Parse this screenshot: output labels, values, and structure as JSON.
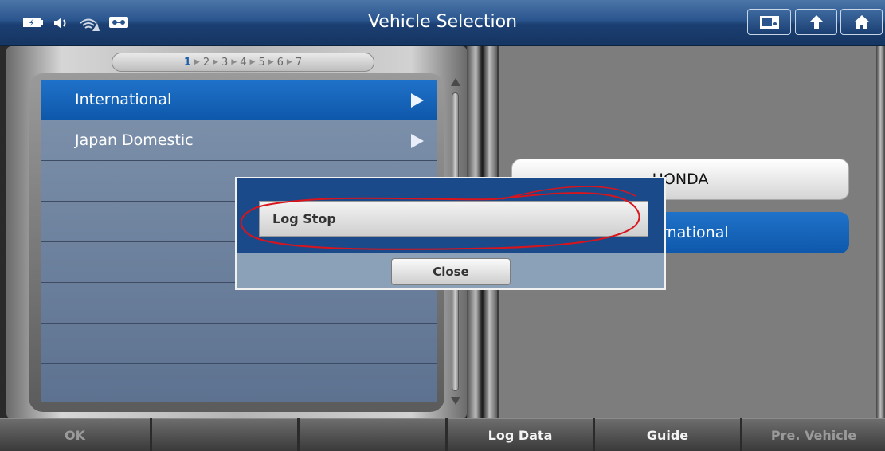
{
  "header": {
    "title": "Vehicle Selection"
  },
  "status_icons": [
    "battery-icon",
    "speaker-icon",
    "wifi-icon",
    "cassette-icon"
  ],
  "toolbar_buttons": [
    "screenshot-icon",
    "back-icon",
    "home-icon"
  ],
  "steps": {
    "current": "1",
    "items": [
      "1",
      "2",
      "3",
      "4",
      "5",
      "6",
      "7"
    ]
  },
  "list": {
    "items": [
      {
        "label": "International",
        "selected": true
      },
      {
        "label": "Japan Domestic",
        "selected": false
      }
    ]
  },
  "selection": {
    "make": "HONDA",
    "region": "International"
  },
  "dialog": {
    "log_button": "Log Stop",
    "close_button": "Close"
  },
  "bottom_bar": [
    {
      "label": "OK",
      "enabled": false
    },
    {
      "label": "",
      "enabled": false
    },
    {
      "label": "",
      "enabled": false
    },
    {
      "label": "Log Data",
      "enabled": true
    },
    {
      "label": "Guide",
      "enabled": true
    },
    {
      "label": "Pre. Vehicle",
      "enabled": false
    }
  ],
  "colors": {
    "header": "#2a558e",
    "selected": "#0e58ab",
    "panel": "#7d7d7d",
    "annotation": "#d8141c"
  }
}
